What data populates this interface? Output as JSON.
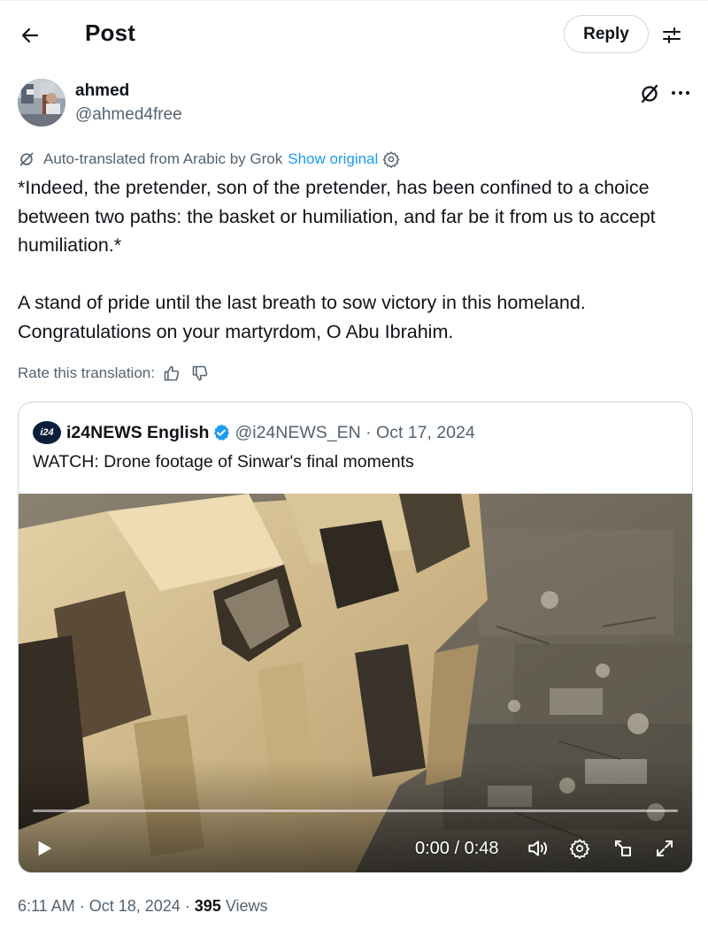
{
  "header": {
    "title": "Post",
    "reply_label": "Reply"
  },
  "author": {
    "display_name": "ahmed",
    "handle": "@ahmed4free"
  },
  "translation": {
    "notice": "Auto-translated from Arabic by Grok",
    "show_original": "Show original",
    "rate_label": "Rate this translation:"
  },
  "post": {
    "paragraphs": [
      "*Indeed, the pretender, son of the pretender, has been confined to a choice between two paths: the basket or humiliation, and far be it from us to accept humiliation.*",
      "A stand of pride until the last breath to sow victory in this homeland. Congratulations on your martyrdom, O Abu Ibrahim."
    ]
  },
  "quote": {
    "logo_text": "i24",
    "name": "i24NEWS English",
    "handle_date": "@i24NEWS_EN · Oct 17, 2024",
    "text": "WATCH: Drone footage of Sinwar's final moments",
    "video": {
      "timecode": "0:00 / 0:48",
      "progress": 0
    }
  },
  "meta": {
    "time_date": "6:11 AM · Oct 18, 2024 · ",
    "views_count": "395",
    "views_label": " Views"
  },
  "icons": {
    "back": "arrow-left-icon",
    "settings": "sliders-icon",
    "grok": "grok-icon",
    "more": "more-dots-icon",
    "gear": "gear-icon",
    "thumbs_up": "thumbs-up-icon",
    "thumbs_down": "thumbs-down-icon",
    "verified": "verified-badge-icon",
    "play": "play-icon",
    "volume": "volume-icon",
    "pip": "picture-in-picture-icon",
    "fullscreen": "expand-icon"
  },
  "colors": {
    "link": "#1d9bf0",
    "secondary_text": "#536471",
    "primary_text": "#0f1419",
    "border": "#cfd9de"
  }
}
